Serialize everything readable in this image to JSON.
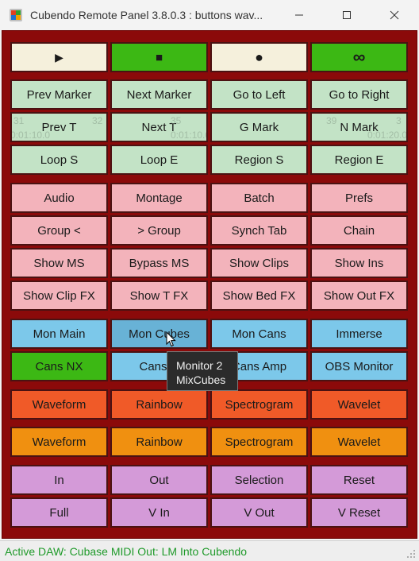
{
  "window": {
    "title": "Cubendo Remote Panel 3.8.0.3 : buttons wav..."
  },
  "icons": {
    "app": "cube-app-icon",
    "minimize": "minimize-icon",
    "maximize": "maximize-icon",
    "close": "close-icon"
  },
  "transport": {
    "play_symbol": "▶",
    "stop_symbol": "■",
    "record_symbol": "●",
    "cycle_symbol": "∞"
  },
  "markers": {
    "row1": [
      "Prev Marker",
      "Next Marker",
      "Go to Left",
      "Go to Right"
    ],
    "row2": [
      "Prev T",
      "Next T",
      "G Mark",
      "N Mark"
    ],
    "row3": [
      "Loop S",
      "Loop E",
      "Region S",
      "Region E"
    ]
  },
  "ghost_ruler": {
    "n31": "31",
    "n32": "32",
    "n35": "35",
    "n39": "39",
    "n3": "3",
    "t1": "0:01:10.0",
    "t2": "0:01:20.0"
  },
  "windows": {
    "row1": [
      "Audio",
      "Montage",
      "Batch",
      "Prefs"
    ],
    "row2": [
      "Group <",
      "> Group",
      "Synch Tab",
      "Chain"
    ],
    "row3": [
      "Show MS",
      "Bypass MS",
      "Show Clips",
      "Show Ins"
    ],
    "row4": [
      "Show Clip FX",
      "Show T FX",
      "Show Bed FX",
      "Show Out FX"
    ]
  },
  "monitor": {
    "row1": [
      "Mon Main",
      "Mon Cubes",
      "Mon Cans",
      "Immerse"
    ],
    "row2": [
      "Cans NX",
      "Cans D",
      "Cans Amp",
      "OBS Monitor"
    ]
  },
  "display1": [
    "Waveform",
    "Rainbow",
    "Spectrogram",
    "Wavelet"
  ],
  "display2": [
    "Waveform",
    "Rainbow",
    "Spectrogram",
    "Wavelet"
  ],
  "edit": {
    "row1": [
      "In",
      "Out",
      "Selection",
      "Reset"
    ],
    "row2": [
      "Full",
      "V In",
      "V Out",
      "V Reset"
    ]
  },
  "tooltip": {
    "line1": "Monitor 2",
    "line2": "MixCubes"
  },
  "status": {
    "text": "Active DAW: Cubase  MIDI Out: LM Into Cubendo"
  },
  "colors": {
    "panel": "#8b0a0a",
    "transport_light": "#f5f0dc",
    "transport_green": "#3cb814",
    "mint": "#c3e3c6",
    "pink": "#f3b3bb",
    "blue": "#7cc8ea",
    "red": "#f05a28",
    "orange": "#f09010",
    "violet": "#d49ad8",
    "status_text": "#1f9a2a"
  }
}
